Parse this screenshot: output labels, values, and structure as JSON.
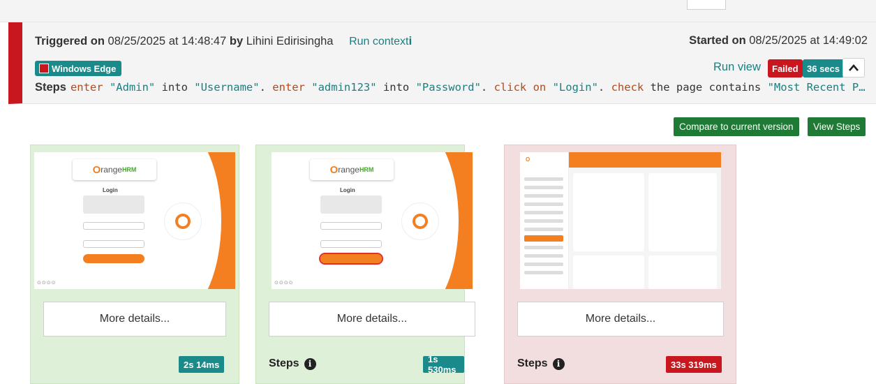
{
  "header": {
    "triggered_label": "Triggered on",
    "triggered_date": "08/25/2025 at 14:48:47",
    "by_label": "by",
    "user": "Lihini Edirisingha",
    "run_context": "Run context",
    "run_context_icon": "i",
    "started_label": "Started on",
    "started_date": "08/25/2025 at 14:49:02",
    "environment": "Windows Edge",
    "run_view": "Run view",
    "status": "Failed",
    "duration": "36 secs",
    "steps_label": "Steps",
    "steps_text": [
      {
        "t": "kw",
        "v": "enter "
      },
      {
        "t": "str",
        "v": "\"Admin\""
      },
      {
        "t": "plain",
        "v": " into "
      },
      {
        "t": "str",
        "v": "\"Username\""
      },
      {
        "t": "plain",
        "v": ". "
      },
      {
        "t": "kw",
        "v": "enter "
      },
      {
        "t": "str",
        "v": "\"admin123\""
      },
      {
        "t": "plain",
        "v": " into "
      },
      {
        "t": "str",
        "v": "\"Password\""
      },
      {
        "t": "plain",
        "v": ". "
      },
      {
        "t": "kw",
        "v": "click on "
      },
      {
        "t": "str",
        "v": "\"Login\""
      },
      {
        "t": "plain",
        "v": ". "
      },
      {
        "t": "kw",
        "v": "check "
      },
      {
        "t": "plain",
        "v": "the page contains "
      },
      {
        "t": "str",
        "v": "\"Most Recent P…"
      }
    ]
  },
  "actions": {
    "compare": "Compare to current version",
    "view_steps": "View Steps"
  },
  "cards": [
    {
      "status": "pass",
      "details": "More details...",
      "steps": "",
      "time": "2s 14ms"
    },
    {
      "status": "pass",
      "details": "More details...",
      "steps": "Steps",
      "time": "1s 530ms"
    },
    {
      "status": "fail",
      "details": "More details...",
      "steps": "Steps",
      "time": "33s 319ms"
    }
  ],
  "thumbnail": {
    "login_title": "Login",
    "logo_text": "range",
    "logo_o": "O",
    "logo_hrm": "HRM",
    "dots": "⊙⊙⊙⊙"
  },
  "colors": {
    "fail_red": "#c8171e",
    "teal": "#1b8a8a",
    "green_btn": "#1e7a34",
    "pass_bg": "#dff0d8",
    "fail_bg": "#f2dede",
    "orange": "#f47f21"
  },
  "icons": {
    "collapse": "chevron-up-icon",
    "info": "info-icon",
    "env": "browser-status-icon"
  }
}
